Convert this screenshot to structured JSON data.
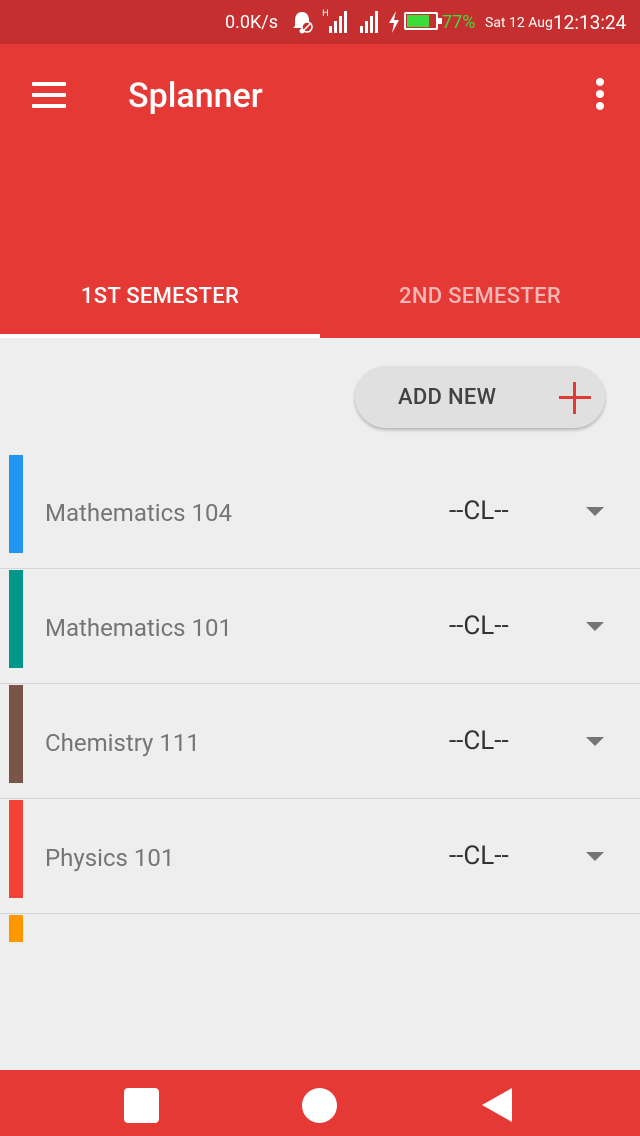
{
  "status_bar": {
    "net_speed": "0.0K/s",
    "battery_percent": "77%",
    "battery_level": 0.77,
    "date": "Sat 12 Aug",
    "time": "12:13:24",
    "icons": [
      "muted-bell-icon",
      "h-signal-icon",
      "signal-icon",
      "charging-icon",
      "battery-icon"
    ]
  },
  "app_bar": {
    "title": "Splanner",
    "menu_icon": "hamburger-menu-icon",
    "more_icon": "more-vert-icon"
  },
  "tabs": [
    {
      "label": "1ST SEMESTER",
      "selected": true
    },
    {
      "label": "2ND SEMESTER",
      "selected": false
    }
  ],
  "add_new": {
    "label": "ADD NEW",
    "icon": "plus-icon"
  },
  "courses": [
    {
      "name": "Mathematics 104",
      "grade": "--CL--",
      "color": "#2196F3"
    },
    {
      "name": "Mathematics 101",
      "grade": "--CL--",
      "color": "#009688"
    },
    {
      "name": "Chemistry 111",
      "grade": "--CL--",
      "color": "#795548"
    },
    {
      "name": "Physics 101",
      "grade": "--CL--",
      "color": "#F44336"
    }
  ],
  "partial_course_color": "#FF9800",
  "colors": {
    "primary": "#E53935",
    "status_bar": "#C62F2F",
    "accent": "#E53935",
    "background": "#EEEEEE"
  },
  "nav_bar": {
    "icons": [
      "recent-apps-icon",
      "home-icon",
      "back-icon"
    ]
  }
}
